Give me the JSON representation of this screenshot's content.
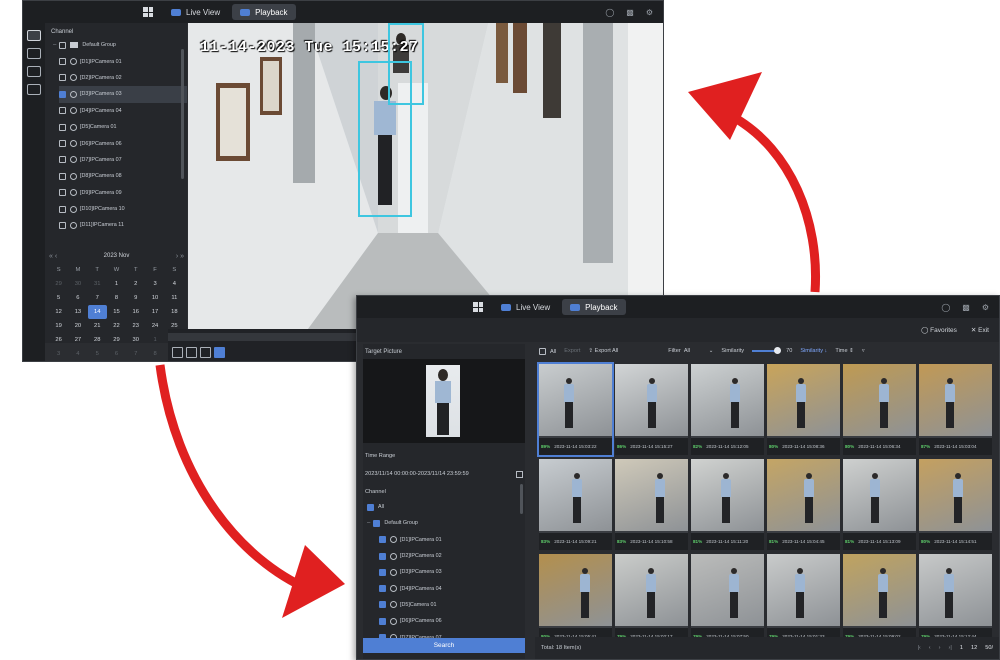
{
  "playback_window": {
    "tabs": [
      {
        "label": "Live View",
        "active": false
      },
      {
        "label": "Playback",
        "active": true
      }
    ],
    "channel_header": "Channel",
    "group_label": "Default Group",
    "channels": [
      {
        "label": "[D1]IPCamera 01",
        "checked": false
      },
      {
        "label": "[D2]IPCamera 02",
        "checked": false
      },
      {
        "label": "[D3]IPCamera 03",
        "checked": true
      },
      {
        "label": "[D4]IPCamera 04",
        "checked": false
      },
      {
        "label": "[D5]Camera 01",
        "checked": false
      },
      {
        "label": "[D6]IPCamera 06",
        "checked": false
      },
      {
        "label": "[D7]IPCamera 07",
        "checked": false
      },
      {
        "label": "[D8]IPCamera 08",
        "checked": false
      },
      {
        "label": "[D9]IPCamera 09",
        "checked": false
      },
      {
        "label": "[D10]IPCamera 10",
        "checked": false
      },
      {
        "label": "[D11]IPCamera 11",
        "checked": false
      }
    ],
    "calendar": {
      "title": "2023 Nov",
      "weekdays": [
        "S",
        "M",
        "T",
        "W",
        "T",
        "F",
        "S"
      ],
      "days": [
        [
          "29",
          "dim"
        ],
        [
          "30",
          "dim"
        ],
        [
          "31",
          "dim"
        ],
        [
          "1",
          ""
        ],
        [
          "2",
          ""
        ],
        [
          "3",
          ""
        ],
        [
          "4",
          ""
        ],
        [
          "5",
          ""
        ],
        [
          "6",
          ""
        ],
        [
          "7",
          ""
        ],
        [
          "8",
          ""
        ],
        [
          "9",
          ""
        ],
        [
          "10",
          ""
        ],
        [
          "11",
          ""
        ],
        [
          "12",
          ""
        ],
        [
          "13",
          ""
        ],
        [
          "14",
          "today"
        ],
        [
          "15",
          ""
        ],
        [
          "16",
          ""
        ],
        [
          "17",
          ""
        ],
        [
          "18",
          ""
        ],
        [
          "19",
          ""
        ],
        [
          "20",
          ""
        ],
        [
          "21",
          ""
        ],
        [
          "22",
          ""
        ],
        [
          "23",
          ""
        ],
        [
          "24",
          ""
        ],
        [
          "25",
          ""
        ],
        [
          "26",
          ""
        ],
        [
          "27",
          ""
        ],
        [
          "28",
          ""
        ],
        [
          "29",
          ""
        ],
        [
          "30",
          ""
        ],
        [
          "1",
          "dim"
        ],
        [
          "2",
          "dim"
        ],
        [
          "3",
          "dim"
        ],
        [
          "4",
          "dim"
        ],
        [
          "5",
          "dim"
        ],
        [
          "6",
          "dim"
        ],
        [
          "7",
          "dim"
        ],
        [
          "8",
          "dim"
        ],
        [
          "9",
          "dim"
        ]
      ]
    },
    "osd_timestamp": "11-14-2023 Tue 15:15:27"
  },
  "search_window": {
    "tabs": [
      {
        "label": "Live View",
        "active": false
      },
      {
        "label": "Playback",
        "active": true
      }
    ],
    "favorites_label": "Favorites",
    "exit_label": "Exit",
    "target_picture_label": "Target Picture",
    "time_range_label": "Time Range",
    "time_range_value": "2023/11/14 00:00:00-2023/11/14 23:59:59",
    "channel_label": "Channel",
    "all_label": "All",
    "group_label": "Default Group",
    "channels": [
      "[D1]IPCamera 01",
      "[D2]IPCamera 02",
      "[D3]IPCamera 03",
      "[D4]IPCamera 04",
      "[D5]Camera 01",
      "[D6]IPCamera 06",
      "[D7]IPCamera 07"
    ],
    "search_button": "Search",
    "toolbar": {
      "all": "All",
      "export": "Export",
      "export_all": "Export All",
      "filter_label": "Filter",
      "filter_value": "All",
      "similarity_label": "Similarity",
      "similarity_value": "70",
      "sort_similarity": "Similarity",
      "sort_time": "Time"
    },
    "results": [
      {
        "pct": "89%",
        "time": "2023-11-14 15:03:22",
        "bg": "#c9cdcf"
      },
      {
        "pct": "86%",
        "time": "2023-11-14 15:15:27",
        "bg": "#d2d5d6"
      },
      {
        "pct": "82%",
        "time": "2023-11-14 15:12:05",
        "bg": "#cdd1d2"
      },
      {
        "pct": "80%",
        "time": "2023-11-14 15:08:36",
        "bg": "#c9a45a"
      },
      {
        "pct": "80%",
        "time": "2023-11-14 15:06:34",
        "bg": "#bf9a52"
      },
      {
        "pct": "87%",
        "time": "2023-11-14 15:03:04",
        "bg": "#c19955"
      },
      {
        "pct": "83%",
        "time": "2023-11-14 15:09:21",
        "bg": "#c7ccd0"
      },
      {
        "pct": "83%",
        "time": "2023-11-14 15:10:58",
        "bg": "#cfc9b9"
      },
      {
        "pct": "81%",
        "time": "2023-11-14 15:11:20",
        "bg": "#d0d2d0"
      },
      {
        "pct": "81%",
        "time": "2023-11-14 15:04:45",
        "bg": "#c4a565"
      },
      {
        "pct": "81%",
        "time": "2023-11-14 15:13:09",
        "bg": "#ced0cf"
      },
      {
        "pct": "80%",
        "time": "2023-11-14 15:14:51",
        "bg": "#c4a060"
      },
      {
        "pct": "80%",
        "time": "2023-11-14 15:05:41",
        "bg": "#b38f4d"
      },
      {
        "pct": "79%",
        "time": "2023-11-14 15:02:17",
        "bg": "#caccca"
      },
      {
        "pct": "79%",
        "time": "2023-11-14 15:07:50",
        "bg": "#bbbcbb"
      },
      {
        "pct": "79%",
        "time": "2023-11-14 15:01:33",
        "bg": "#c9cbcb"
      },
      {
        "pct": "79%",
        "time": "2023-11-14 15:09:02",
        "bg": "#c0a35f"
      },
      {
        "pct": "79%",
        "time": "2023-11-14 15:12:44",
        "bg": "#c7c9c9"
      }
    ],
    "total_label": "Total: 18 Item(s)",
    "pager": {
      "current": "1",
      "total": "12",
      "per_page": "50/"
    }
  },
  "colors": {
    "accent": "#4f7fd4",
    "detection_box": "#3ec6e0",
    "similarity_text": "#5fd06c",
    "arrow": "#e02020"
  }
}
